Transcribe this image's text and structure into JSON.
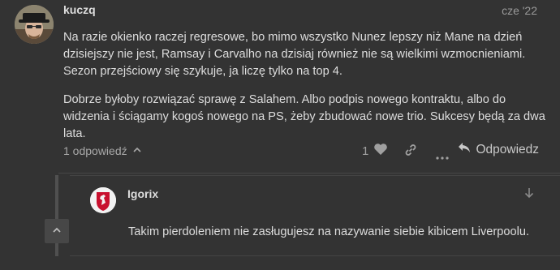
{
  "post": {
    "username": "kuczq",
    "date": "cze '22",
    "paragraphs": [
      "Na razie okienko raczej regresowe, bo mimo wszystko Nunez lepszy niż Mane na dzień dzisiejszy nie jest, Ramsay i Carvalho na dzisiaj również nie są wielkimi wzmocnieniami. Sezon przejściowy się szykuje, ja liczę tylko na top 4.",
      "Dobrze byłoby rozwiązać sprawę z Salahem. Albo podpis nowego kontraktu, albo do widzenia i ściągamy kogoś nowego na PS, żeby zbudować nowe trio. Sukcesy będą za dwa lata."
    ]
  },
  "controls": {
    "replies_label": "1 odpowiedź",
    "like_count": "1",
    "reply_label": "Odpowiedz"
  },
  "reply": {
    "username": "Igorix",
    "text": "Takim pierdoleniem nie zasługujesz na nazywanie siebie kibicem Liverpoolu."
  },
  "colors": {
    "background": "#333333",
    "text": "#dddddd",
    "muted": "#a8a8a8",
    "reply_avatar_red": "#c8102e"
  },
  "icons": {
    "replies_toggle": "chevron-up-icon",
    "like": "heart-icon",
    "link": "link-icon",
    "more": "ellipsis-icon",
    "reply": "reply-arrow-icon",
    "reply_to": "arrow-down-icon",
    "collapse": "chevron-up-icon"
  }
}
